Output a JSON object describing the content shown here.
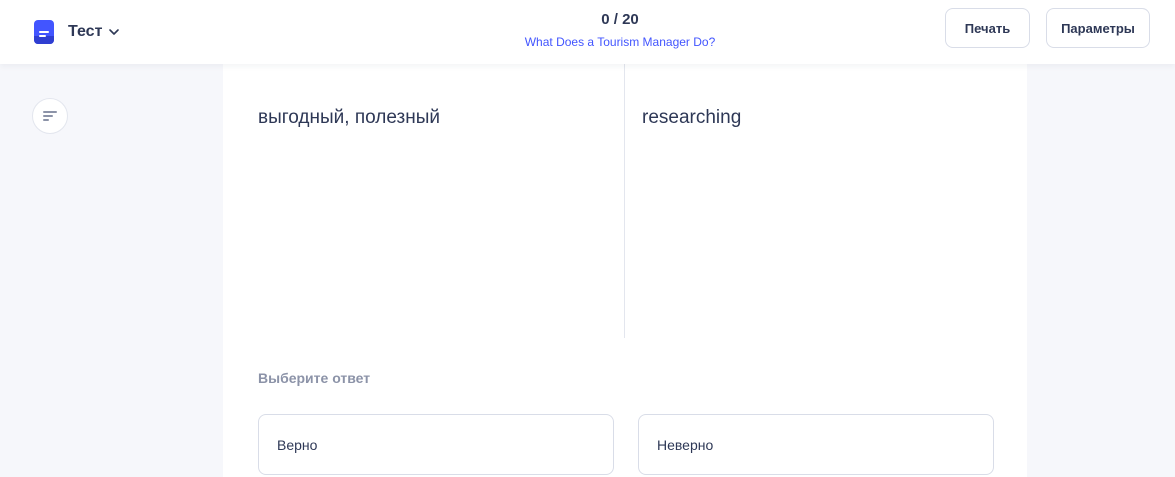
{
  "header": {
    "mode": {
      "label": "Тест",
      "icon": "study-set-icon"
    },
    "progress": {
      "count": "0 / 20",
      "title": "What Does a Tourism Manager Do?"
    },
    "print_label": "Печать",
    "options_label": "Параметры"
  },
  "sidebar": {
    "icon": "filter-lines-icon"
  },
  "question": {
    "left_term": "выгодный, полезный",
    "right_term": "researching",
    "prompt": "Выберите ответ",
    "answers": [
      "Верно",
      "Неверно"
    ]
  },
  "colors": {
    "accent": "#4255ff",
    "text": "#2e3856",
    "muted": "#8c93a8",
    "background": "#f6f7fb",
    "border": "#d9dde8"
  }
}
